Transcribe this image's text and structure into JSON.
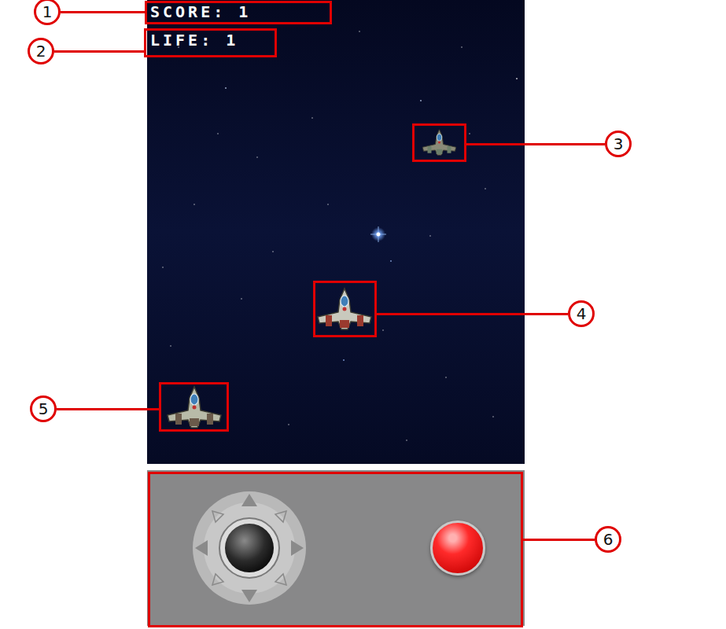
{
  "hud": {
    "score": "SCORE: 1",
    "life": "LIFE: 1"
  },
  "callouts": [
    {
      "label": "1"
    },
    {
      "label": "2"
    },
    {
      "label": "3"
    },
    {
      "label": "4"
    },
    {
      "label": "5"
    },
    {
      "label": "6"
    }
  ]
}
